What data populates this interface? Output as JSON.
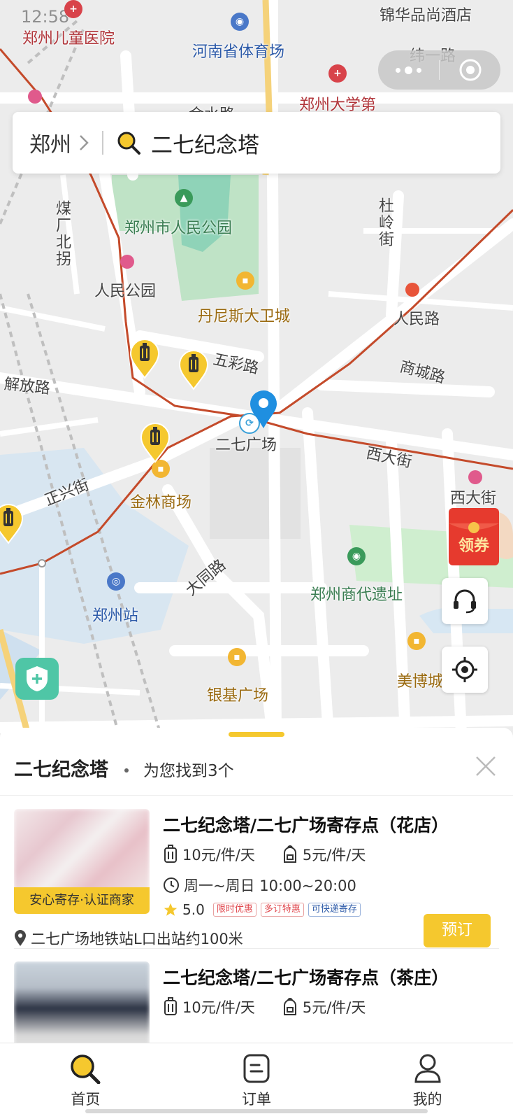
{
  "status_bar": {
    "time": "12:58"
  },
  "capsule": {
    "more_icon": "more-dots-icon",
    "close_icon": "target-circle-icon"
  },
  "search": {
    "city": "郑州",
    "query": "二七纪念塔",
    "icon": "search-icon"
  },
  "map": {
    "labels": {
      "jinhua": "锦华品尚酒店",
      "children_hospital": "郑州儿童医院",
      "stadium": "河南省体育场",
      "weiyi_road": "纬一路",
      "zzu": "郑州大学第",
      "jinshui_road": "金水路",
      "people_park_big": "郑州市人民公园",
      "meichang": "煤厂北拐",
      "dulingjie": "杜岭街",
      "people_park": "人民公园",
      "dennis": "丹尼斯大卫城",
      "renmin_road": "人民路",
      "wucai_road": "五彩路",
      "shangcheng_road": "商城路",
      "jiefang_road": "解放路",
      "erqi_square": "二七广场",
      "xidajie_road": "西大街",
      "zhengxingjie": "正兴街",
      "jinlin": "金林商场",
      "xidajie_station": "西大街",
      "datong_road": "大同路",
      "shang_ruins": "郑州商代遗址",
      "zhengzhou_station": "郑州站",
      "yinji": "银基广场",
      "meibo": "美博城"
    },
    "coupon_label": "领券",
    "support_icon": "headset-icon",
    "locate_icon": "locate-icon",
    "shield_icon": "shield-plus-icon"
  },
  "sheet": {
    "title": "二七纪念塔",
    "count_text": "为您找到3个",
    "close_icon": "close-icon",
    "results": [
      {
        "name": "二七纪念塔/二七广场寄存点（花店）",
        "badge": "安心寄存·认证商家",
        "price_large": "10元/件/天",
        "price_small": "5元/件/天",
        "hours": "周一~周日 10:00~20:00",
        "rating": "5.0",
        "tags": [
          "限时优惠",
          "多订特惠",
          "可快递寄存"
        ],
        "address": "二七广场地铁站L口出站约100米",
        "book_label": "预订"
      },
      {
        "name": "二七纪念塔/二七广场寄存点（茶庄）",
        "price_large": "10元/件/天",
        "price_small": "5元/件/天"
      }
    ]
  },
  "tabbar": {
    "tabs": [
      {
        "label": "首页",
        "icon": "search-icon"
      },
      {
        "label": "订单",
        "icon": "order-icon"
      },
      {
        "label": "我的",
        "icon": "user-icon"
      }
    ]
  }
}
